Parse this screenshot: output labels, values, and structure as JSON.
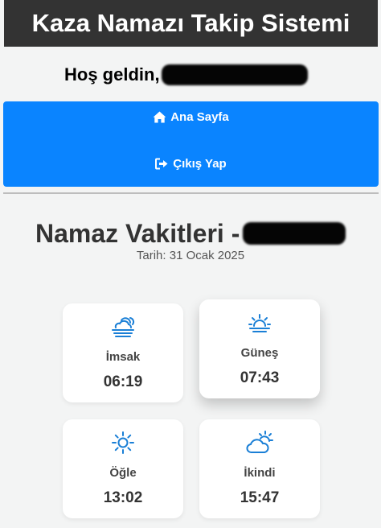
{
  "header": {
    "title": "Kaza Namazı Takip Sistemi"
  },
  "welcome": {
    "greeting": "Hoş geldin,"
  },
  "nav": {
    "items": [
      {
        "label": "Ana Sayfa",
        "icon": "home-icon"
      },
      {
        "label": "Çıkış Yap",
        "icon": "logout-icon"
      }
    ]
  },
  "prayer_times": {
    "title": "Namaz Vakitleri -",
    "date": "Tarih: 31 Ocak 2025",
    "cards": [
      {
        "name": "İmsak",
        "time": "06:19",
        "icon": "fog-cloud-icon"
      },
      {
        "name": "Güneş",
        "time": "07:43",
        "icon": "sunrise-icon"
      },
      {
        "name": "Öğle",
        "time": "13:02",
        "icon": "sun-icon"
      },
      {
        "name": "İkindi",
        "time": "15:47",
        "icon": "cloud-sun-icon"
      }
    ]
  },
  "colors": {
    "header_bg": "#333333",
    "nav_bg": "#0a84ff",
    "icon": "#1a7fd6",
    "page_bg": "#f3f4f4"
  }
}
